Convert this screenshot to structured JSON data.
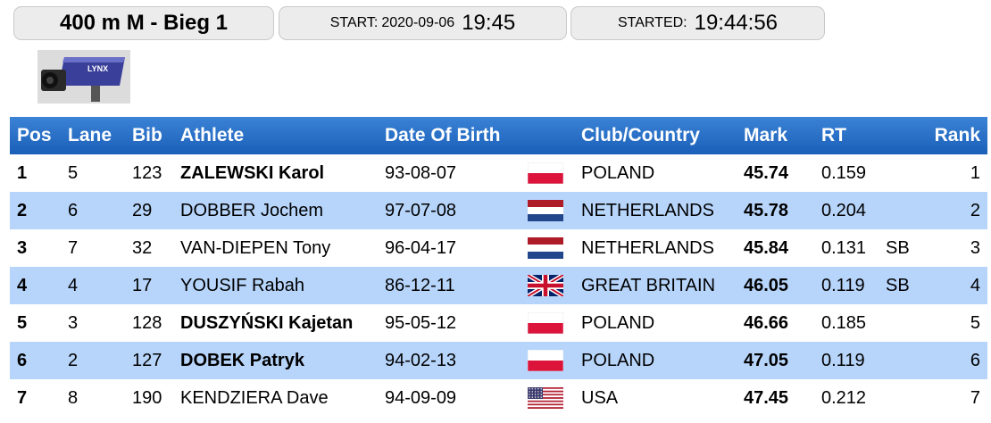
{
  "header": {
    "event_title": "400 m M - Bieg 1",
    "start_label": "START:",
    "start_date": "2020-09-06",
    "start_time": "19:45",
    "started_label": "STARTED:",
    "started_time": "19:44:56"
  },
  "logo": {
    "text": "LYNX",
    "icon": "camera-icon"
  },
  "colors": {
    "header_blue": "#1a5fb8",
    "row_alt": "#b7d5fb",
    "pill_bg": "#ececec"
  },
  "table": {
    "columns": [
      "Pos",
      "Lane",
      "Bib",
      "Athlete",
      "Date Of Birth",
      "Club/Country",
      "Mark",
      "RT",
      "Rank"
    ],
    "rows": [
      {
        "pos": "1",
        "lane": "5",
        "bib": "123",
        "athlete": "ZALEWSKI Karol",
        "athlete_bold": true,
        "dob": "93-08-07",
        "flag": "poland-flag-icon",
        "country": "POLAND",
        "mark": "45.74",
        "rt": "0.159",
        "note": "",
        "rank": "1"
      },
      {
        "pos": "2",
        "lane": "6",
        "bib": "29",
        "athlete": "DOBBER Jochem",
        "athlete_bold": false,
        "dob": "97-07-08",
        "flag": "netherlands-flag-icon",
        "country": "NETHERLANDS",
        "mark": "45.78",
        "rt": "0.204",
        "note": "",
        "rank": "2"
      },
      {
        "pos": "3",
        "lane": "7",
        "bib": "32",
        "athlete": "VAN-DIEPEN Tony",
        "athlete_bold": false,
        "dob": "96-04-17",
        "flag": "netherlands-flag-icon",
        "country": "NETHERLANDS",
        "mark": "45.84",
        "rt": "0.131",
        "note": "SB",
        "rank": "3"
      },
      {
        "pos": "4",
        "lane": "4",
        "bib": "17",
        "athlete": "YOUSIF Rabah",
        "athlete_bold": false,
        "dob": "86-12-11",
        "flag": "great-britain-flag-icon",
        "country": "GREAT BRITAIN",
        "mark": "46.05",
        "rt": "0.119",
        "note": "SB",
        "rank": "4"
      },
      {
        "pos": "5",
        "lane": "3",
        "bib": "128",
        "athlete": "DUSZYŃSKI Kajetan",
        "athlete_bold": true,
        "dob": "95-05-12",
        "flag": "poland-flag-icon",
        "country": "POLAND",
        "mark": "46.66",
        "rt": "0.185",
        "note": "",
        "rank": "5"
      },
      {
        "pos": "6",
        "lane": "2",
        "bib": "127",
        "athlete": "DOBEK Patryk",
        "athlete_bold": true,
        "dob": "94-02-13",
        "flag": "poland-flag-icon",
        "country": "POLAND",
        "mark": "47.05",
        "rt": "0.119",
        "note": "",
        "rank": "6"
      },
      {
        "pos": "7",
        "lane": "8",
        "bib": "190",
        "athlete": "KENDZIERA Dave",
        "athlete_bold": false,
        "dob": "94-09-09",
        "flag": "usa-flag-icon",
        "country": "USA",
        "mark": "47.45",
        "rt": "0.212",
        "note": "",
        "rank": "7"
      }
    ]
  }
}
